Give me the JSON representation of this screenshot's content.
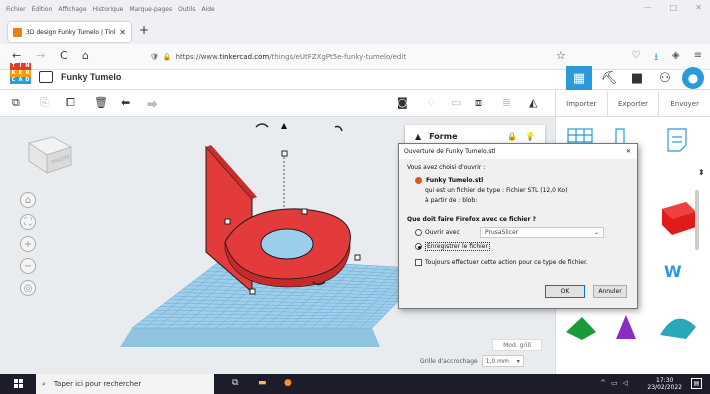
{
  "browser": {
    "menu": [
      "Fichier",
      "Édition",
      "Affichage",
      "Historique",
      "Marque-pages",
      "Outils",
      "Aide"
    ],
    "window_controls": [
      "—",
      "□",
      "✕"
    ],
    "tab_title": "3D design Funky Tumelo | Tink",
    "tab_close": "✕",
    "new_tab": "+",
    "url_prefix": "https://www.",
    "url_host": "tinkercad.com",
    "url_path": "/things/eUtFZXgPt5e-funky-tumelo/edit",
    "back": "←",
    "forward": "→",
    "reload": "C",
    "home": "⌂",
    "bookmark": "☆"
  },
  "tinkercad": {
    "logo_letters": [
      "T",
      "I",
      "N",
      "K",
      "E",
      "R",
      "C",
      "A",
      "D"
    ],
    "logo_colors": [
      "#e03e2d",
      "#e03e2d",
      "#e03e2d",
      "#f39c12",
      "#f39c12",
      "#f39c12",
      "#27a0d8",
      "#27a0d8",
      "#27a0d8"
    ],
    "design_title": "Funky Tumelo",
    "side_tabs": [
      "Importer",
      "Exporter",
      "Envoyer"
    ],
    "shape_panel_title": "Forme",
    "snap_label": "Grille d'accrochage",
    "snap_value": "1,0 mm",
    "mod_grill": "Mod. grill",
    "viewcube_label": "DROITE",
    "accent_color": "#2a9bd8"
  },
  "dialog": {
    "title": "Ouverture de Funky Tumelo.stl",
    "close": "✕",
    "intro": "Vous avez choisi d'ouvrir :",
    "filename": "Funky Tumelo.stl",
    "filetype": "qui est un fichier de type : Fichier STL (12,0 Ko)",
    "source": "à partir de : blob:",
    "question": "Que doit faire Firefox avec ce fichier ?",
    "open_with": "Ouvrir avec",
    "app": "PrusaSlicer",
    "save_file": "Enregistrer le fichier",
    "always": "Toujours effectuer cette action pour ce type de fichier.",
    "ok": "OK",
    "cancel": "Annuler"
  },
  "taskbar": {
    "search_placeholder": "Taper ici pour rechercher",
    "time": "17:30",
    "date": "23/02/2022"
  }
}
